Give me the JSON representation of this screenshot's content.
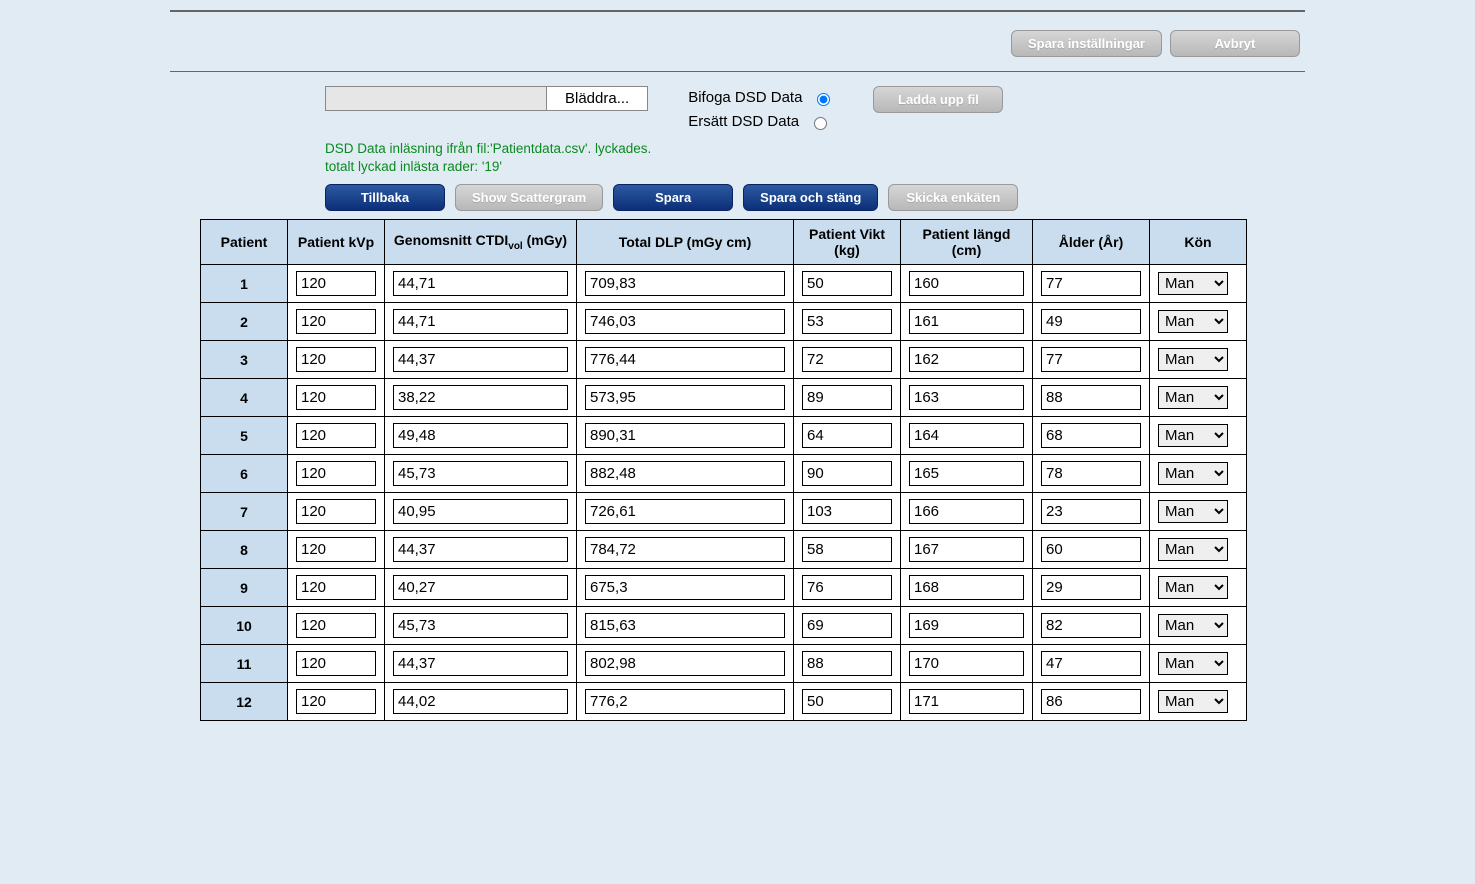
{
  "topbar": {
    "save_settings": "Spara inställningar",
    "cancel": "Avbryt"
  },
  "upload": {
    "browse": "Bläddra...",
    "append_label": "Bifoga DSD Data",
    "replace_label": "Ersätt DSD Data",
    "upload_btn": "Ladda upp fil"
  },
  "status": {
    "line1": "DSD Data inläsning ifrån fil:'Patientdata.csv'. lyckades.",
    "line2": "totalt lyckad inlästa rader: '19'"
  },
  "actions": {
    "back": "Tillbaka",
    "scattergram": "Show Scattergram",
    "save": "Spara",
    "save_close": "Spara och stäng",
    "send_survey": "Skicka enkäten"
  },
  "table": {
    "headers": {
      "patient": "Patient",
      "kvp": "Patient kVp",
      "ctdi_pre": "Genomsnitt CTDI",
      "ctdi_sub": "vol",
      "ctdi_unit": " (mGy)",
      "dlp": "Total DLP (mGy cm)",
      "vikt": "Patient Vikt (kg)",
      "langd": "Patient längd (cm)",
      "alder": "Ålder (År)",
      "kon": "Kön"
    },
    "kon_options": [
      "Man"
    ],
    "rows": [
      {
        "idx": "1",
        "kvp": "120",
        "ctdi": "44,71",
        "dlp": "709,83",
        "vikt": "50",
        "langd": "160",
        "alder": "77",
        "kon": "Man"
      },
      {
        "idx": "2",
        "kvp": "120",
        "ctdi": "44,71",
        "dlp": "746,03",
        "vikt": "53",
        "langd": "161",
        "alder": "49",
        "kon": "Man"
      },
      {
        "idx": "3",
        "kvp": "120",
        "ctdi": "44,37",
        "dlp": "776,44",
        "vikt": "72",
        "langd": "162",
        "alder": "77",
        "kon": "Man"
      },
      {
        "idx": "4",
        "kvp": "120",
        "ctdi": "38,22",
        "dlp": "573,95",
        "vikt": "89",
        "langd": "163",
        "alder": "88",
        "kon": "Man"
      },
      {
        "idx": "5",
        "kvp": "120",
        "ctdi": "49,48",
        "dlp": "890,31",
        "vikt": "64",
        "langd": "164",
        "alder": "68",
        "kon": "Man"
      },
      {
        "idx": "6",
        "kvp": "120",
        "ctdi": "45,73",
        "dlp": "882,48",
        "vikt": "90",
        "langd": "165",
        "alder": "78",
        "kon": "Man"
      },
      {
        "idx": "7",
        "kvp": "120",
        "ctdi": "40,95",
        "dlp": "726,61",
        "vikt": "103",
        "langd": "166",
        "alder": "23",
        "kon": "Man"
      },
      {
        "idx": "8",
        "kvp": "120",
        "ctdi": "44,37",
        "dlp": "784,72",
        "vikt": "58",
        "langd": "167",
        "alder": "60",
        "kon": "Man"
      },
      {
        "idx": "9",
        "kvp": "120",
        "ctdi": "40,27",
        "dlp": "675,3",
        "vikt": "76",
        "langd": "168",
        "alder": "29",
        "kon": "Man"
      },
      {
        "idx": "10",
        "kvp": "120",
        "ctdi": "45,73",
        "dlp": "815,63",
        "vikt": "69",
        "langd": "169",
        "alder": "82",
        "kon": "Man"
      },
      {
        "idx": "11",
        "kvp": "120",
        "ctdi": "44,37",
        "dlp": "802,98",
        "vikt": "88",
        "langd": "170",
        "alder": "47",
        "kon": "Man"
      },
      {
        "idx": "12",
        "kvp": "120",
        "ctdi": "44,02",
        "dlp": "776,2",
        "vikt": "50",
        "langd": "171",
        "alder": "86",
        "kon": "Man"
      }
    ]
  }
}
